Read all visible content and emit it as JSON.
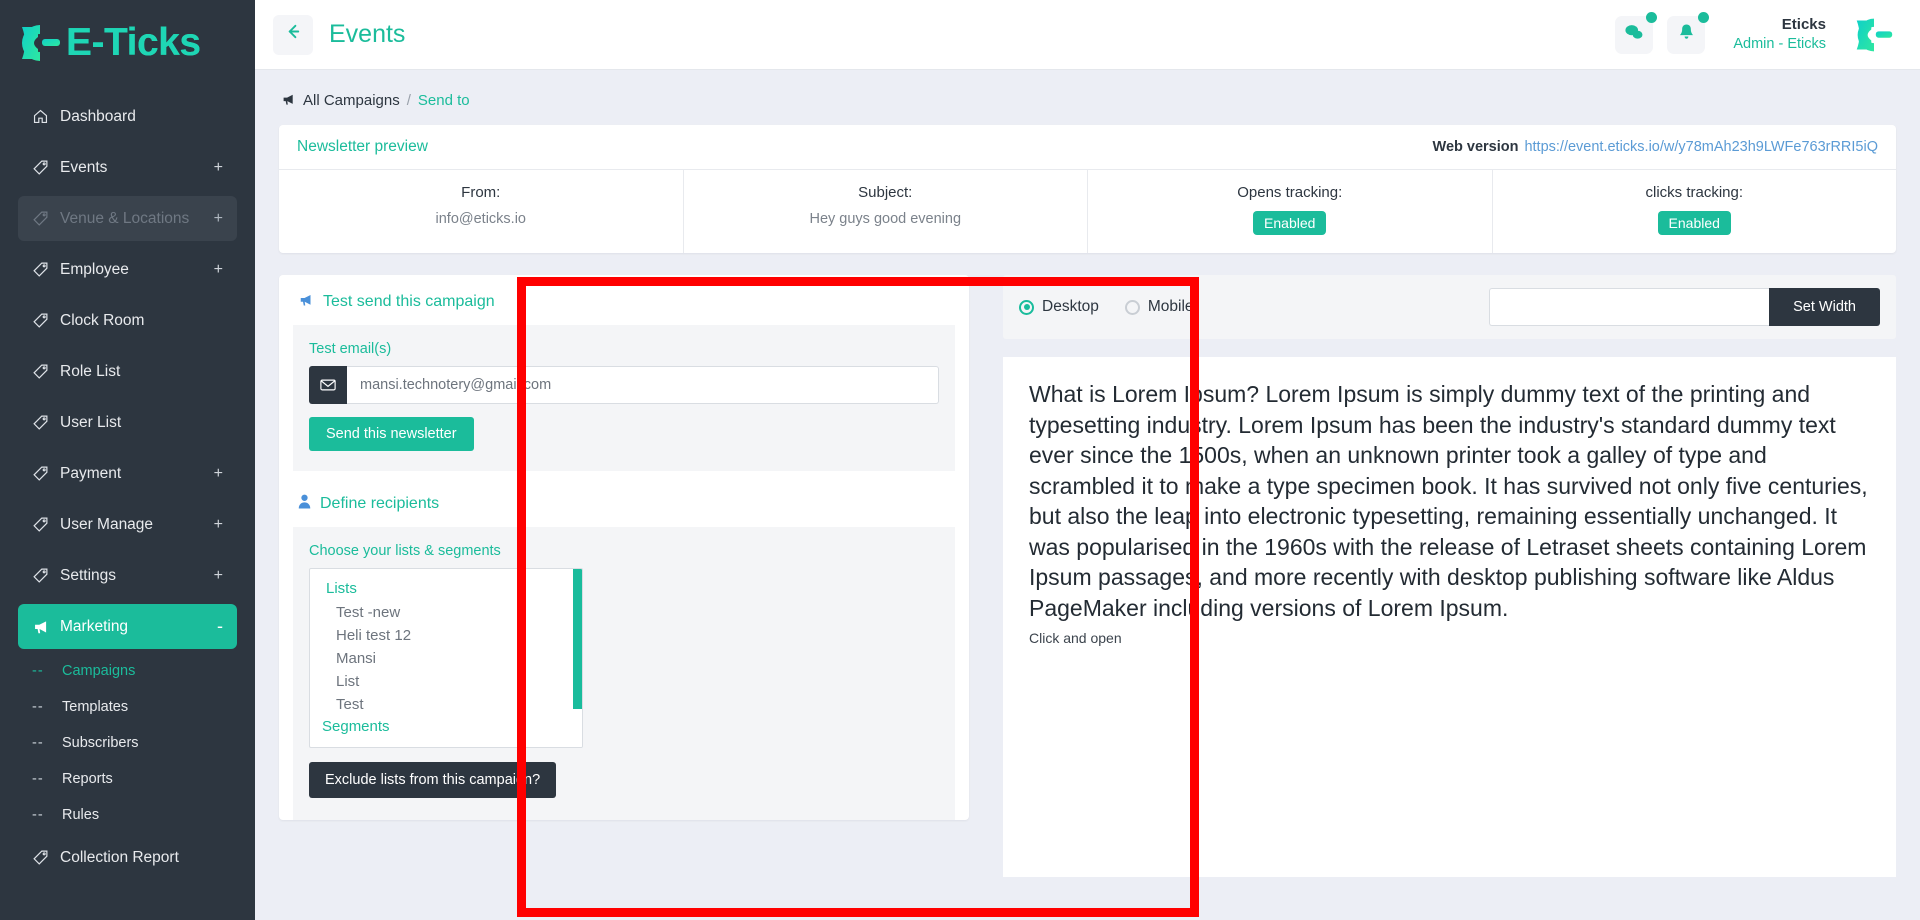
{
  "brand": {
    "name": "E-Ticks"
  },
  "sidebar": {
    "items": [
      {
        "label": "Dashboard",
        "icon": "home-icon",
        "expander": "",
        "state": "normal"
      },
      {
        "label": "Events",
        "icon": "tag-icon",
        "expander": "+",
        "state": "normal"
      },
      {
        "label": "Venue & Locations",
        "icon": "tag-icon",
        "expander": "+",
        "state": "muted"
      },
      {
        "label": "Employee",
        "icon": "tag-icon",
        "expander": "+",
        "state": "normal"
      },
      {
        "label": "Clock Room",
        "icon": "tag-icon",
        "expander": "",
        "state": "normal"
      },
      {
        "label": "Role List",
        "icon": "tag-icon",
        "expander": "",
        "state": "normal"
      },
      {
        "label": "User List",
        "icon": "tag-icon",
        "expander": "",
        "state": "normal"
      },
      {
        "label": "Payment",
        "icon": "tag-icon",
        "expander": "+",
        "state": "normal"
      },
      {
        "label": "User Manage",
        "icon": "tag-icon",
        "expander": "+",
        "state": "normal"
      },
      {
        "label": "Settings",
        "icon": "tag-icon",
        "expander": "+",
        "state": "normal"
      },
      {
        "label": "Marketing",
        "icon": "megaphone-icon",
        "expander": "-",
        "state": "active"
      }
    ],
    "subitems": [
      {
        "label": "Campaigns",
        "dash": "--",
        "current": true
      },
      {
        "label": "Templates",
        "dash": "--",
        "current": false
      },
      {
        "label": "Subscribers",
        "dash": "--",
        "current": false
      },
      {
        "label": "Reports",
        "dash": "--",
        "current": false
      },
      {
        "label": "Rules",
        "dash": "--",
        "current": false
      }
    ],
    "footer_item": {
      "label": "Collection Report",
      "icon": "tag-icon"
    }
  },
  "topbar": {
    "back_icon": "arrow-left-icon",
    "title": "Events",
    "chat_icon": "chat-bubbles-icon",
    "bell_icon": "bell-icon",
    "user_name": "Eticks",
    "user_role": "Admin - Eticks"
  },
  "breadcrumb": {
    "icon": "megaphone-icon",
    "root": "All Campaigns",
    "separator": "/",
    "current": "Send to"
  },
  "newsletter_preview": {
    "title": "Newsletter preview",
    "web_version_label": "Web version",
    "web_version_url": "https://event.eticks.io/w/y78mAh23h9LWFe763rRRI5iQ",
    "columns": [
      {
        "key": "From:",
        "value": "info@eticks.io",
        "type": "text"
      },
      {
        "key": "Subject:",
        "value": "Hey guys good evening",
        "type": "text"
      },
      {
        "key": "Opens tracking:",
        "value": "Enabled",
        "type": "badge"
      },
      {
        "key": "clicks tracking:",
        "value": "Enabled",
        "type": "badge"
      }
    ]
  },
  "test_send": {
    "icon": "megaphone-icon",
    "title": "Test send this campaign",
    "field_label": "Test email(s)",
    "email_icon": "envelope-icon",
    "email_value": "mansi.technotery@gmail.com",
    "email_placeholder": "mansi.technotery@gmail.com",
    "send_button": "Send this newsletter"
  },
  "define_recipients": {
    "icon": "user-icon",
    "title": "Define recipients",
    "choose_label": "Choose your lists & segments",
    "groups": [
      {
        "name": "Lists",
        "options": [
          "Test -new",
          "Heli test 12",
          "Mansi",
          "List",
          "Test"
        ]
      },
      {
        "name": "Segments",
        "options": []
      }
    ],
    "exclude_button": "Exclude lists from this campaign?"
  },
  "preview_controls": {
    "desktop_label": "Desktop",
    "mobile_label": "Mobile",
    "selected": "Desktop",
    "width_value": "",
    "width_placeholder": "",
    "set_width_button": "Set Width"
  },
  "preview_body": {
    "paragraph": "What is Lorem Ipsum? Lorem Ipsum is simply dummy text of the printing and typesetting industry. Lorem Ipsum has been the industry's standard dummy text ever since the 1500s, when an unknown printer took a galley of type and scrambled it to make a type specimen book. It has survived not only five centuries, but also the leap into electronic typesetting, remaining essentially unchanged. It was popularised in the 1960s with the release of Letraset sheets containing Lorem Ipsum passages, and more recently with desktop publishing software like Aldus PageMaker including versions of Lorem Ipsum.",
    "link_text": "Click and open"
  },
  "colors": {
    "accent": "#1bbc9b",
    "sidebar": "#2d3640",
    "highlight": "#ff0000",
    "link": "#5b9bd5"
  }
}
